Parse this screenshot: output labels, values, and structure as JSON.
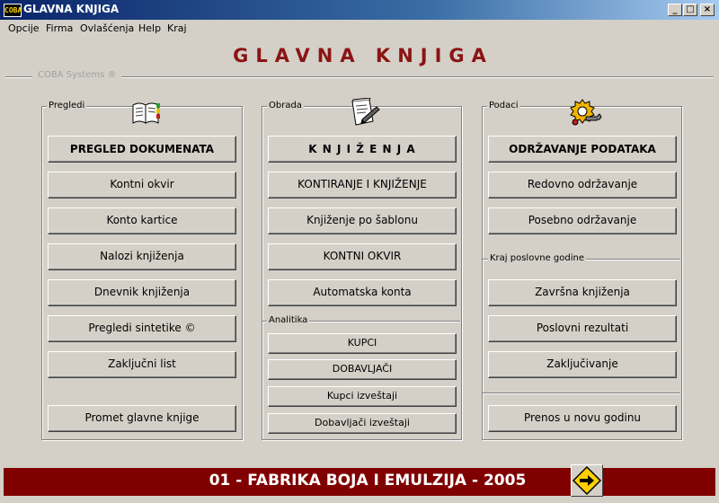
{
  "window": {
    "title": "GLAVNA KNJIGA",
    "app_icon_text": "COBA"
  },
  "menu": [
    "Opcije",
    "Firma",
    "Ovlašćenja",
    "Help",
    "Kraj"
  ],
  "header": {
    "title": "GLAVNA KNJIGA",
    "vendor": "COBA Systems ®"
  },
  "pregledi": {
    "label": "Pregledi",
    "icon": "book-icon",
    "buttons": [
      "PREGLED DOKUMENATA",
      "Kontni okvir",
      "Konto kartice",
      "Nalozi knjiženja",
      "Dnevnik knjiženja",
      "Pregledi sintetike ©",
      "Zaključni list",
      "Promet glavne knjige"
    ]
  },
  "obrada": {
    "label": "Obrada",
    "icon": "document-pen-icon",
    "buttons": [
      "K N J I Ž E N J A",
      "KONTIRANJE I KNJIŽENJE",
      "Knjiženje po šablonu",
      "KONTNI OKVIR",
      "Automatska konta"
    ],
    "analitika": {
      "label": "Analitika",
      "buttons": [
        "KUPCI",
        "DOBAVLJAČI",
        "Kupci izveštaji",
        "Dobavljači izveštaji"
      ]
    }
  },
  "podaci": {
    "label": "Podaci",
    "icon": "gear-wrench-icon",
    "buttons": [
      "ODRŽAVANJE PODATAKA",
      "Redovno održavanje",
      "Posebno održavanje"
    ],
    "kraj_godine": {
      "label": "Kraj poslovne godine",
      "buttons": [
        "Završna knjiženja",
        "Poslovni rezultati",
        "Zaključivanje"
      ]
    },
    "prenos": "Prenos u novu godinu"
  },
  "footer": {
    "company": "01 - FABRIKA BOJA I EMULZIJA - 2005",
    "next_icon": "arrow-right-sign-icon"
  },
  "colors": {
    "title_red": "#8b1414",
    "footer_bg": "#800000",
    "face": "#d4d0c8"
  }
}
